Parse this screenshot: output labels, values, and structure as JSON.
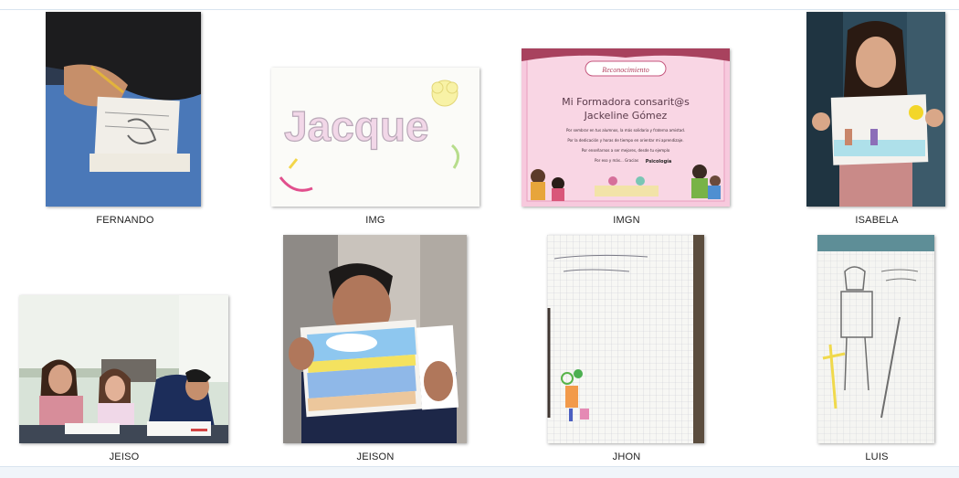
{
  "files": [
    {
      "name": "FERNANDO",
      "icon": "photo-thumbnail-icon"
    },
    {
      "name": "IMG",
      "icon": "photo-thumbnail-icon"
    },
    {
      "name": "IMGN",
      "icon": "photo-thumbnail-icon"
    },
    {
      "name": "ISABELA",
      "icon": "photo-thumbnail-icon"
    },
    {
      "name": "JEISO",
      "icon": "photo-thumbnail-icon"
    },
    {
      "name": "JEISON",
      "icon": "photo-thumbnail-icon"
    },
    {
      "name": "JHON",
      "icon": "photo-thumbnail-icon"
    },
    {
      "name": "LUIS",
      "icon": "photo-thumbnail-icon"
    }
  ],
  "thumbnail_text": {
    "img_drawing": "Jacque",
    "imgn_banner": "Reconocimiento",
    "imgn_title_1": "Mi Formadora consarit@s",
    "imgn_title_2": "Jackeline Gómez",
    "imgn_line_1": "Por sembrar en tus alumnos, la más solidaria y fraterna amistad.",
    "imgn_line_2": "Por la dedicación y horas de tiempo en orientar mi aprendizaje.",
    "imgn_line_3": "Por enseñarnos a ser mejores, desde tu ejemplo",
    "imgn_line_4": "Por eso y más... Gracias",
    "imgn_signature": "Psicología"
  },
  "colors": {
    "window_bg": "#ffffff",
    "separator": "#d9e4ef",
    "label_text": "#1e1e1e"
  }
}
